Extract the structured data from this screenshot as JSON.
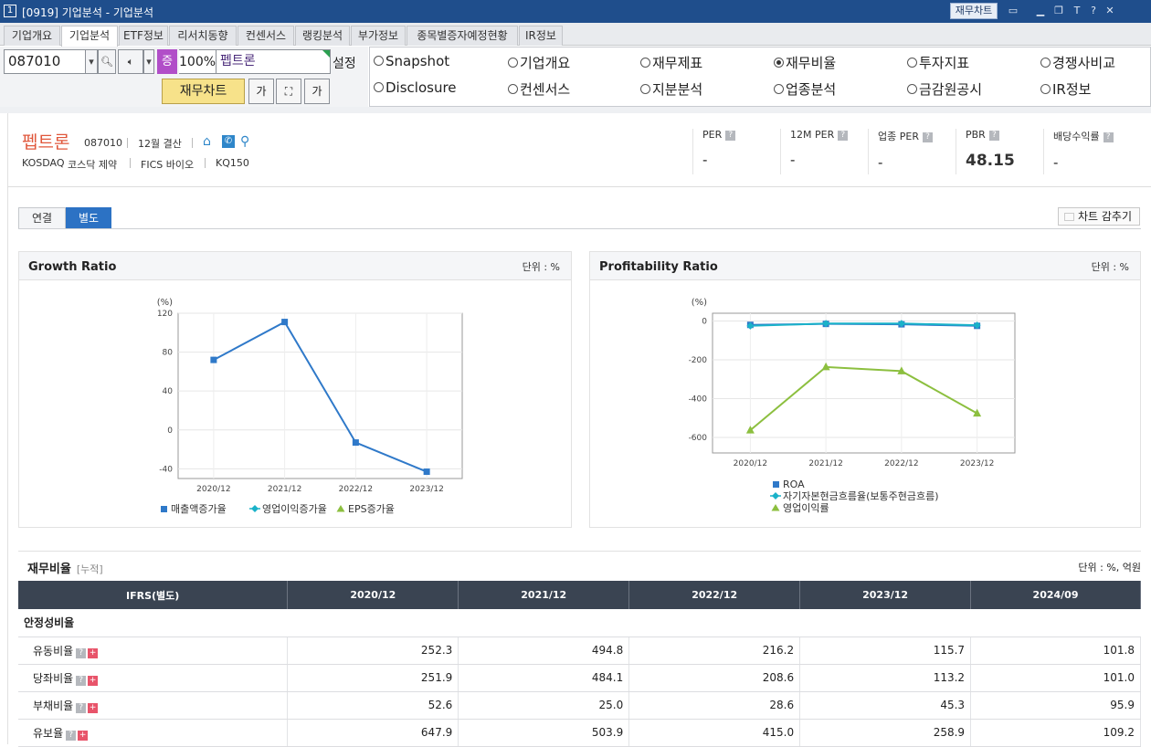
{
  "window": {
    "num": "1",
    "title": "[0919] 기업분석 - 기업분석",
    "chart_btn": "재무차트",
    "icons": [
      "window-icon",
      "minimize-icon",
      "restore-icon",
      "font-icon",
      "help-icon",
      "close-icon"
    ]
  },
  "tabs": [
    "기업개요",
    "기업분석",
    "ETF정보",
    "리서치동향",
    "컨센서스",
    "랭킹분석",
    "부가정보",
    "종목별증자예정현황",
    "IR정보"
  ],
  "active_tab": 1,
  "toolbar": {
    "code": "087010",
    "jung": "증",
    "pct": "100%",
    "name": "펩트론",
    "setting": "설정",
    "fin_chart": "재무차트",
    "btn1": "가",
    "btn3": "가"
  },
  "radios": [
    {
      "label": "Snapshot",
      "checked": false
    },
    {
      "label": "기업개요",
      "checked": false
    },
    {
      "label": "재무제표",
      "checked": false
    },
    {
      "label": "재무비율",
      "checked": true
    },
    {
      "label": "투자지표",
      "checked": false
    },
    {
      "label": "경쟁사비교",
      "checked": false
    },
    {
      "label": "Disclosure",
      "checked": false
    },
    {
      "label": "컨센서스",
      "checked": false
    },
    {
      "label": "지분분석",
      "checked": false
    },
    {
      "label": "업종분석",
      "checked": false
    },
    {
      "label": "금감원공시",
      "checked": false
    },
    {
      "label": "IR정보",
      "checked": false
    }
  ],
  "company": {
    "name": "펩트론",
    "code": "087010",
    "fiscal": "12월 결산",
    "market": "KOSDAQ",
    "sector": "코스닥 제약",
    "fics": "FICS 바이오",
    "index": "KQ150"
  },
  "stats": [
    {
      "label": "PER",
      "value": "-"
    },
    {
      "label": "12M PER",
      "value": "-"
    },
    {
      "label": "업종 PER",
      "value": "-"
    },
    {
      "label": "PBR",
      "value": "48.15"
    },
    {
      "label": "배당수익률",
      "value": "-"
    }
  ],
  "subtabs": {
    "consolidated": "연결",
    "separate": "별도",
    "hide": "차트 감추기"
  },
  "chart_data": [
    {
      "type": "line",
      "title": "Growth Ratio",
      "unit": "단위 : %",
      "ylabel": "(%)",
      "categories": [
        "2020/12",
        "2021/12",
        "2022/12",
        "2023/12"
      ],
      "ylim": [
        -50,
        120
      ],
      "yticks": [
        120,
        80,
        40,
        0,
        -40
      ],
      "series": [
        {
          "name": "매출액증가율",
          "color": "#2f79c9",
          "marker": "square",
          "values": [
            72,
            111,
            -13,
            -43
          ]
        },
        {
          "name": "영업이익증가율",
          "color": "#1ab2c9",
          "marker": "diamond",
          "values": [
            null,
            null,
            null,
            null
          ]
        },
        {
          "name": "EPS증가율",
          "color": "#8cbf3f",
          "marker": "triangle",
          "values": [
            null,
            null,
            null,
            null
          ]
        }
      ],
      "legend": "bottom"
    },
    {
      "type": "line",
      "title": "Profitability Ratio",
      "unit": "단위 : %",
      "ylabel": "(%)",
      "categories": [
        "2020/12",
        "2021/12",
        "2022/12",
        "2023/12"
      ],
      "ylim": [
        -680,
        40
      ],
      "yticks": [
        0,
        -200,
        -400,
        -600
      ],
      "series": [
        {
          "name": "ROA",
          "color": "#2f79c9",
          "marker": "square",
          "values": [
            -20,
            -15,
            -17,
            -25
          ]
        },
        {
          "name": "자기자본현금흐름율(보통주현금흐름)",
          "color": "#1ab2c9",
          "marker": "diamond",
          "values": [
            -25,
            -13,
            -13,
            -22
          ]
        },
        {
          "name": "영업이익률",
          "color": "#8cbf3f",
          "marker": "triangle",
          "values": [
            -563,
            -237,
            -258,
            -476
          ]
        }
      ],
      "legend": "bottom"
    }
  ],
  "ratio": {
    "title": "재무비율",
    "sub": "[누적]",
    "unit": "단위 : %, 억원",
    "header": [
      "IFRS(별도)",
      "2020/12",
      "2021/12",
      "2022/12",
      "2023/12",
      "2024/09"
    ],
    "section": "안정성비율",
    "rows": [
      {
        "label": "유동비율",
        "values": [
          "252.3",
          "494.8",
          "216.2",
          "115.7",
          "101.8"
        ]
      },
      {
        "label": "당좌비율",
        "values": [
          "251.9",
          "484.1",
          "208.6",
          "113.2",
          "101.0"
        ]
      },
      {
        "label": "부채비율",
        "values": [
          "52.6",
          "25.0",
          "28.6",
          "45.3",
          "95.9"
        ]
      },
      {
        "label": "유보율",
        "values": [
          "647.9",
          "503.9",
          "415.0",
          "258.9",
          "109.2"
        ]
      }
    ]
  }
}
